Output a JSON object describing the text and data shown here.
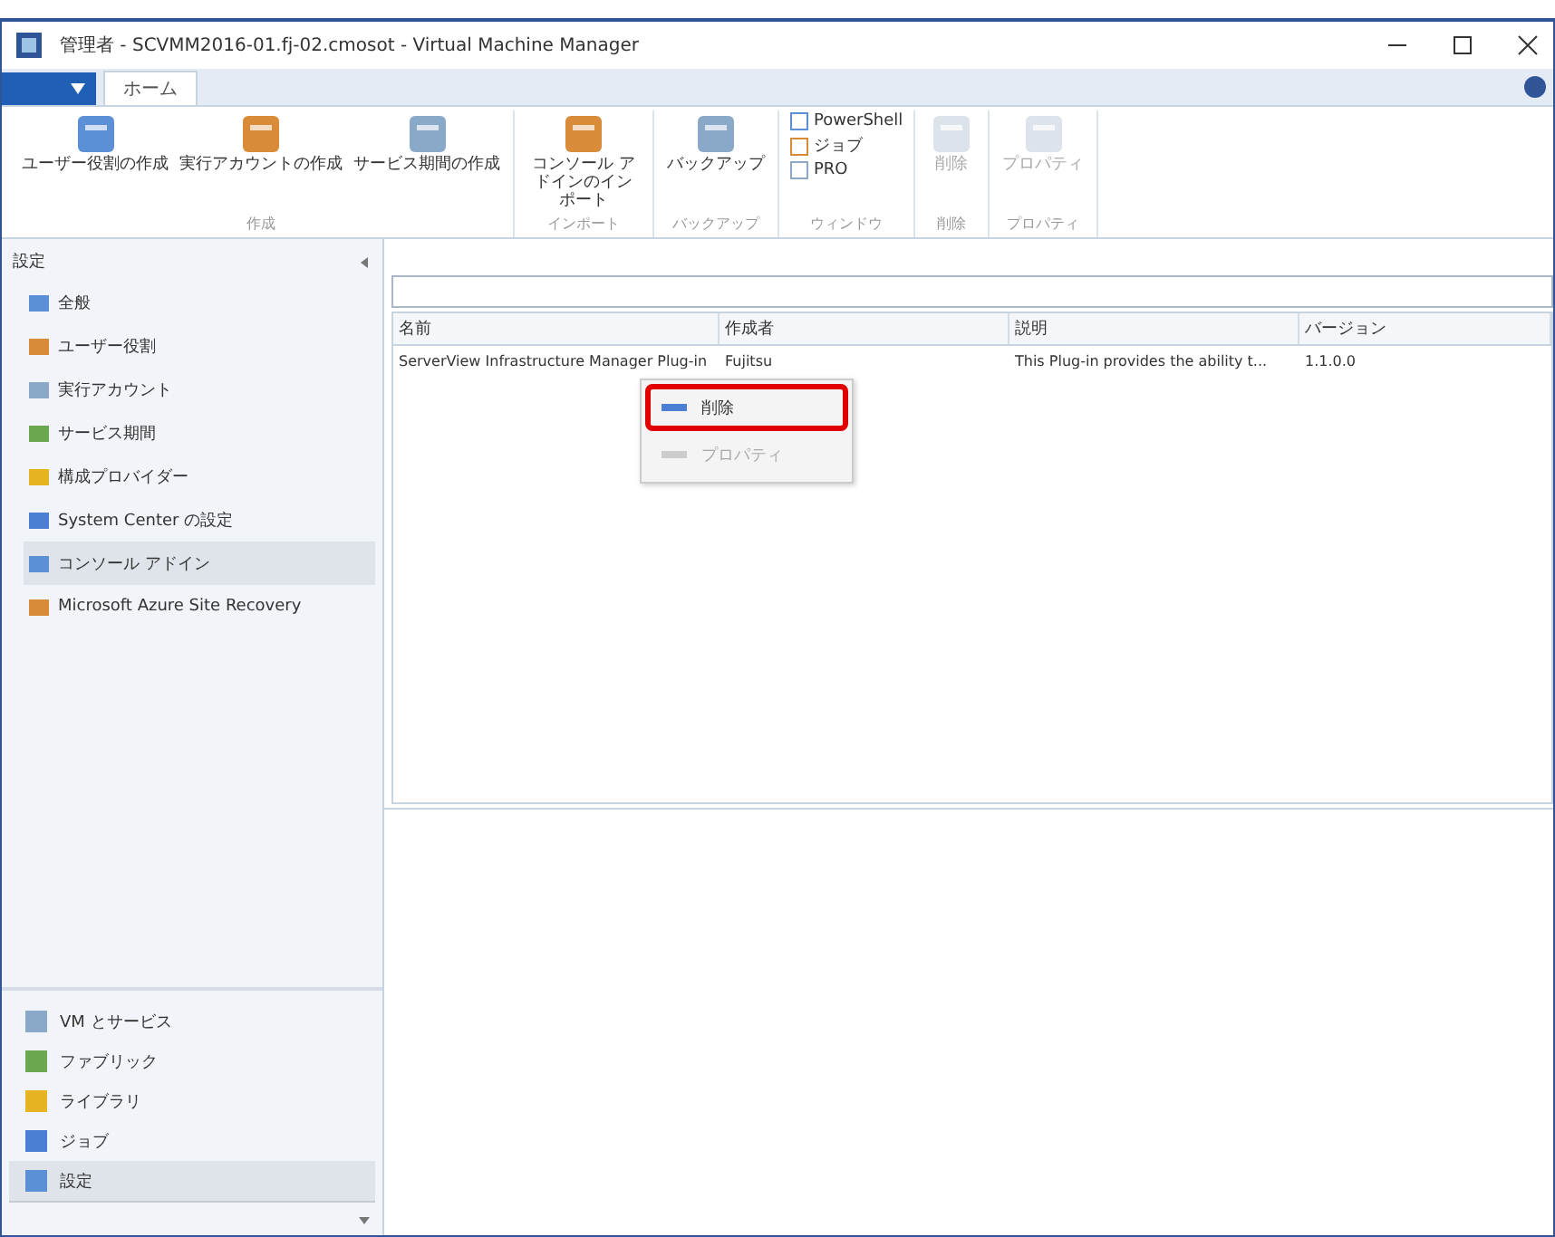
{
  "window": {
    "title": "管理者 - SCVMM2016-01.fj-02.cmosot - Virtual Machine Manager"
  },
  "tabs": [
    {
      "label": "ホーム",
      "selected": true
    }
  ],
  "ribbon": {
    "groups": [
      {
        "label": "作成",
        "kind": "large",
        "buttons": [
          {
            "label": "ユーザー役割の作成",
            "disabled": false
          },
          {
            "label": "実行アカウントの作成",
            "disabled": false
          },
          {
            "label": "サービス期間の作成",
            "disabled": false
          }
        ]
      },
      {
        "label": "インポート",
        "kind": "large",
        "buttons": [
          {
            "label": "コンソール アドインのインポート",
            "disabled": false
          }
        ]
      },
      {
        "label": "バックアップ",
        "kind": "large",
        "buttons": [
          {
            "label": "バックアップ",
            "disabled": false
          }
        ]
      },
      {
        "label": "ウィンドウ",
        "kind": "small",
        "buttons": [
          {
            "label": "PowerShell",
            "disabled": false
          },
          {
            "label": "ジョブ",
            "disabled": false
          },
          {
            "label": "PRO",
            "disabled": false
          }
        ]
      },
      {
        "label": "削除",
        "kind": "large",
        "buttons": [
          {
            "label": "削除",
            "disabled": true
          }
        ]
      },
      {
        "label": "プロパティ",
        "kind": "large",
        "buttons": [
          {
            "label": "プロパティ",
            "disabled": true
          }
        ]
      }
    ]
  },
  "sidebar": {
    "header": "設定",
    "items": [
      {
        "label": "全般",
        "selected": false
      },
      {
        "label": "ユーザー役割",
        "selected": false
      },
      {
        "label": "実行アカウント",
        "selected": false
      },
      {
        "label": "サービス期間",
        "selected": false
      },
      {
        "label": "構成プロバイダー",
        "selected": false
      },
      {
        "label": "System Center の設定",
        "selected": false
      },
      {
        "label": "コンソール アドイン",
        "selected": true
      },
      {
        "label": "Microsoft Azure Site Recovery",
        "selected": false
      }
    ],
    "workspaces": [
      {
        "label": "VM とサービス",
        "selected": false
      },
      {
        "label": "ファブリック",
        "selected": false
      },
      {
        "label": "ライブラリ",
        "selected": false
      },
      {
        "label": "ジョブ",
        "selected": false
      },
      {
        "label": "設定",
        "selected": true
      }
    ]
  },
  "table": {
    "columns": [
      "名前",
      "作成者",
      "説明",
      "バージョン"
    ],
    "rows": [
      {
        "cells": [
          "ServerView Infrastructure Manager Plug-in",
          "Fujitsu",
          "This Plug-in provides the ability t...",
          "1.1.0.0"
        ]
      }
    ]
  },
  "context_menu": {
    "items": [
      {
        "label": "削除",
        "disabled": false,
        "highlighted": true
      },
      {
        "label": "プロパティ",
        "disabled": true,
        "highlighted": false
      }
    ]
  }
}
